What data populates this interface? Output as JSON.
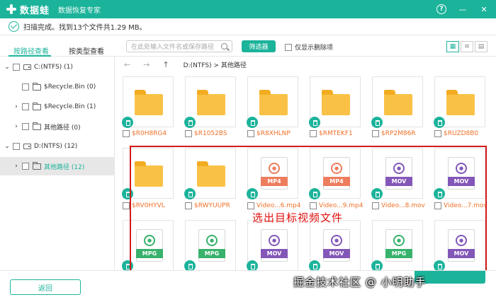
{
  "app": {
    "name": "数据蛙",
    "subtitle": "数据恢复专家"
  },
  "titlebar": {
    "help": "?",
    "minimize": "—",
    "close": "✕"
  },
  "status": {
    "text": "扫描完成。找到13个文件共1.29 MB。"
  },
  "tabs": {
    "by_path": "按路径查看",
    "by_type": "按类型查看"
  },
  "search": {
    "placeholder": "在此处输入文件名或保存路径"
  },
  "filter": {
    "label": "筛选器"
  },
  "only_deleted": {
    "label": "仅显示删除项"
  },
  "view": {
    "icons": [
      "▦",
      "≡",
      "▤"
    ]
  },
  "tree": [
    {
      "chev": "✓",
      "label": "C:(NTFS) (1)",
      "kind": "drive"
    },
    {
      "chev": "",
      "label": "$Recycle.Bin (0)",
      "kind": "folder"
    },
    {
      "chev": "›",
      "label": "$Recycle.Bin (1)",
      "kind": "folder"
    },
    {
      "chev": "›",
      "label": "其他路径 (0)",
      "kind": "folder"
    },
    {
      "chev": "✓",
      "label": "D:(NTFS) (12)",
      "kind": "drive"
    },
    {
      "chev": "›",
      "label": "其他路径 (12)",
      "kind": "folder"
    }
  ],
  "nav": {
    "back": "←",
    "forward": "→",
    "up": "↑"
  },
  "path": {
    "text": "D:(NTFS) > 其他路径"
  },
  "files": [
    {
      "name": "$R0H8RG4",
      "type": "folder"
    },
    {
      "name": "$R1052BS",
      "type": "folder"
    },
    {
      "name": "$R8XHLNP",
      "type": "folder"
    },
    {
      "name": "$RMTEKF1",
      "type": "folder"
    },
    {
      "name": "$RP2M86R",
      "type": "folder"
    },
    {
      "name": "$RUZD8B0",
      "type": "folder"
    },
    {
      "name": "$RV0HYVL",
      "type": "folder"
    },
    {
      "name": "$RWYUUPR",
      "type": "folder"
    },
    {
      "name": "Video...6.mp4",
      "type": "MP4"
    },
    {
      "name": "Video...9.mp4",
      "type": "MP4"
    },
    {
      "name": "Video...8.mov",
      "type": "MOV"
    },
    {
      "name": "Video...7.mov",
      "type": "MOV"
    },
    {
      "name": "",
      "type": "MPG"
    },
    {
      "name": "",
      "type": "MPG"
    },
    {
      "name": "",
      "type": "MOV"
    },
    {
      "name": "",
      "type": "MOV"
    },
    {
      "name": "",
      "type": "MPG"
    },
    {
      "name": "",
      "type": "MOV"
    }
  ],
  "overlay": {
    "text": "选出目标视频文件"
  },
  "bottom": {
    "back": "返回"
  },
  "watermark": {
    "text": "掘金技术社区 @ 小明助手"
  },
  "colors": {
    "accent": "#1cb39b",
    "highlight": "#d41a1a",
    "label": "#f07028"
  }
}
